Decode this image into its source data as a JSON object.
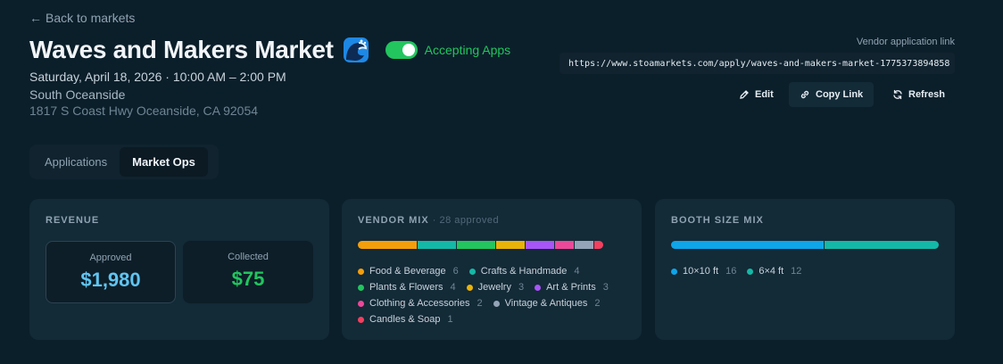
{
  "nav": {
    "back_label": "Back to markets"
  },
  "market": {
    "title": "Waves and Makers Market",
    "status_label": "Accepting Apps",
    "date": "Saturday, April 18, 2026 · 10:00 AM – 2:00 PM",
    "location": "South Oceanside",
    "address": "1817 S Coast Hwy Oceanside, CA 92054"
  },
  "vendor_link": {
    "label": "Vendor application link",
    "url": "https://www.stoamarkets.com/apply/waves-and-makers-market-1775373894858"
  },
  "actions": {
    "edit": "Edit",
    "copy": "Copy Link",
    "refresh": "Refresh"
  },
  "tabs": [
    {
      "label": "Applications",
      "active": false
    },
    {
      "label": "Market Ops",
      "active": true
    }
  ],
  "revenue": {
    "title": "REVENUE",
    "approved_label": "Approved",
    "approved_value": "$1,980",
    "collected_label": "Collected",
    "collected_value": "$75"
  },
  "vendor_mix": {
    "title": "VENDOR MIX",
    "subtitle": "· 28 approved",
    "categories": [
      {
        "name": "Food & Beverage",
        "count": "6",
        "color": "#f59e0b"
      },
      {
        "name": "Crafts & Handmade",
        "count": "4",
        "color": "#14b8a6"
      },
      {
        "name": "Plants & Flowers",
        "count": "4",
        "color": "#22c55e"
      },
      {
        "name": "Jewelry",
        "count": "3",
        "color": "#eab308"
      },
      {
        "name": "Art & Prints",
        "count": "3",
        "color": "#a855f7"
      },
      {
        "name": "Clothing & Accessories",
        "count": "2",
        "color": "#ec4899"
      },
      {
        "name": "Vintage & Antiques",
        "count": "2",
        "color": "#94a3b8"
      },
      {
        "name": "Candles & Soap",
        "count": "1",
        "color": "#f43f5e"
      }
    ]
  },
  "booth_mix": {
    "title": "BOOTH SIZE MIX",
    "sizes": [
      {
        "name": "10×10 ft",
        "count": "16",
        "color": "#0ea5e9"
      },
      {
        "name": "6×4 ft",
        "count": "12",
        "color": "#14b8a6"
      }
    ]
  },
  "colors": {
    "accent": "#22c55e",
    "background": "#0b1f2a",
    "card": "#132a37"
  }
}
